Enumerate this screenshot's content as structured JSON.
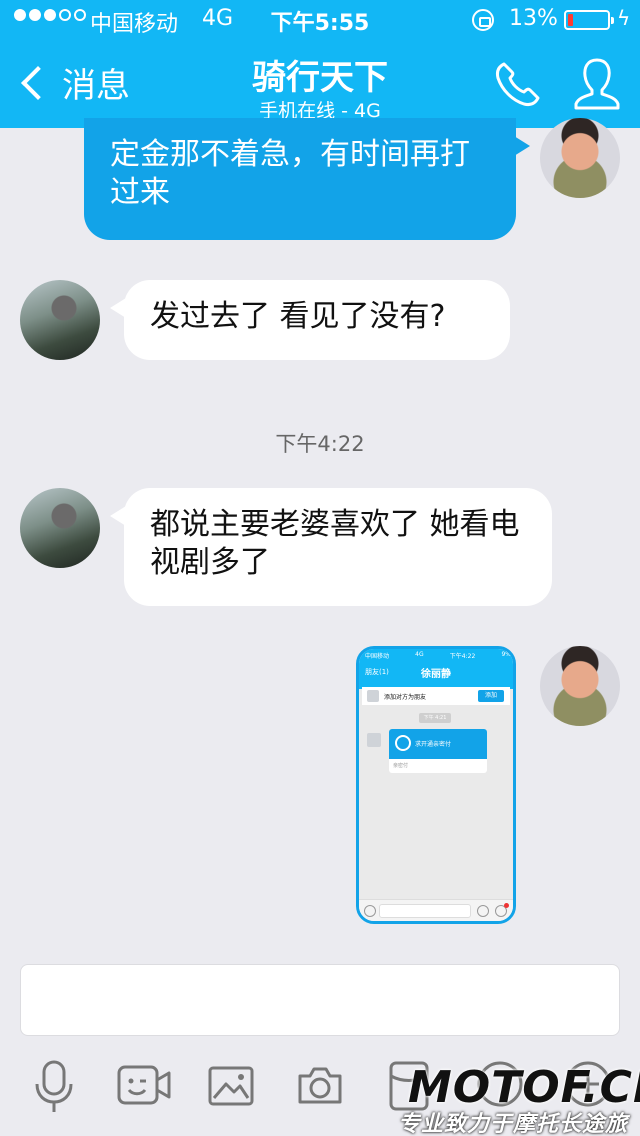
{
  "status_bar": {
    "carrier": "中国移动",
    "network": "4G",
    "time": "下午5:55",
    "battery_percent": "13%",
    "battery_level": 0.13
  },
  "header": {
    "back_label": "消息",
    "title": "骑行天下",
    "subtitle": "手机在线 - 4G"
  },
  "messages": [
    {
      "from": "me",
      "text": "定金那不着急，有时间再打过来"
    },
    {
      "from": "contact",
      "text": "发过去了  看见了没有?"
    },
    {
      "from": "contact",
      "text": "都说主要老婆喜欢了   她看电视剧多了"
    }
  ],
  "timestamp": "下午4:22",
  "image_message": {
    "status_carrier": "中国移动",
    "status_net": "4G",
    "status_time": "下午4:22",
    "status_batt": "9%",
    "back": "朋友(1)",
    "title": "徐丽静",
    "add_bar_text": "添加对方为朋友",
    "add_button": "添加",
    "time": "下午 4:21",
    "card_text": "求开通亲密付",
    "card_footer": "亲密付"
  },
  "toolbar": [
    "mic-icon",
    "video-call-icon",
    "image-icon",
    "camera-icon",
    "red-packet-icon",
    "emoji-icon",
    "plus-icon"
  ],
  "colors": {
    "accent": "#12b7f5",
    "bubble_out": "#12a3e8",
    "background": "#ebebf0"
  },
  "watermark": {
    "logo": "MOTOF.CN",
    "slogan": "专业致力于摩托长途旅行"
  }
}
